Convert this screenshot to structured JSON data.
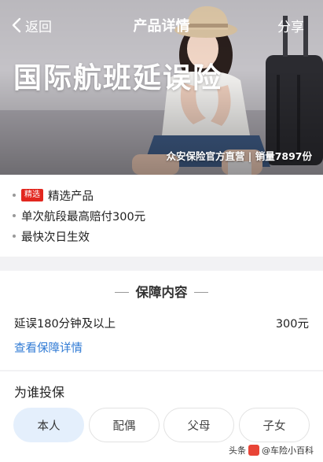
{
  "nav": {
    "back_label": "返回",
    "title": "产品详情",
    "share_label": "分享"
  },
  "hero": {
    "heading": "国际航班延误险",
    "seller_line": "众安保险官方直营 | 销量7897份"
  },
  "highlights": {
    "tag": "精选",
    "items": [
      "精选产品",
      "单次航段最高赔付300元",
      "最快次日生效"
    ]
  },
  "coverage": {
    "title": "保障内容",
    "rows": [
      {
        "label": "延误180分钟及以上",
        "value": "300元"
      }
    ],
    "link_label": "查看保障详情"
  },
  "insured": {
    "title": "为谁投保",
    "options": [
      "本人",
      "配偶",
      "父母",
      "子女"
    ],
    "selected": "本人"
  },
  "watermark": {
    "prefix": "头条",
    "text": "@车险小百科"
  },
  "colors": {
    "tag_red": "#e2271f",
    "link_blue": "#2f7ad4",
    "selected_option_bg": "#e4effc"
  }
}
